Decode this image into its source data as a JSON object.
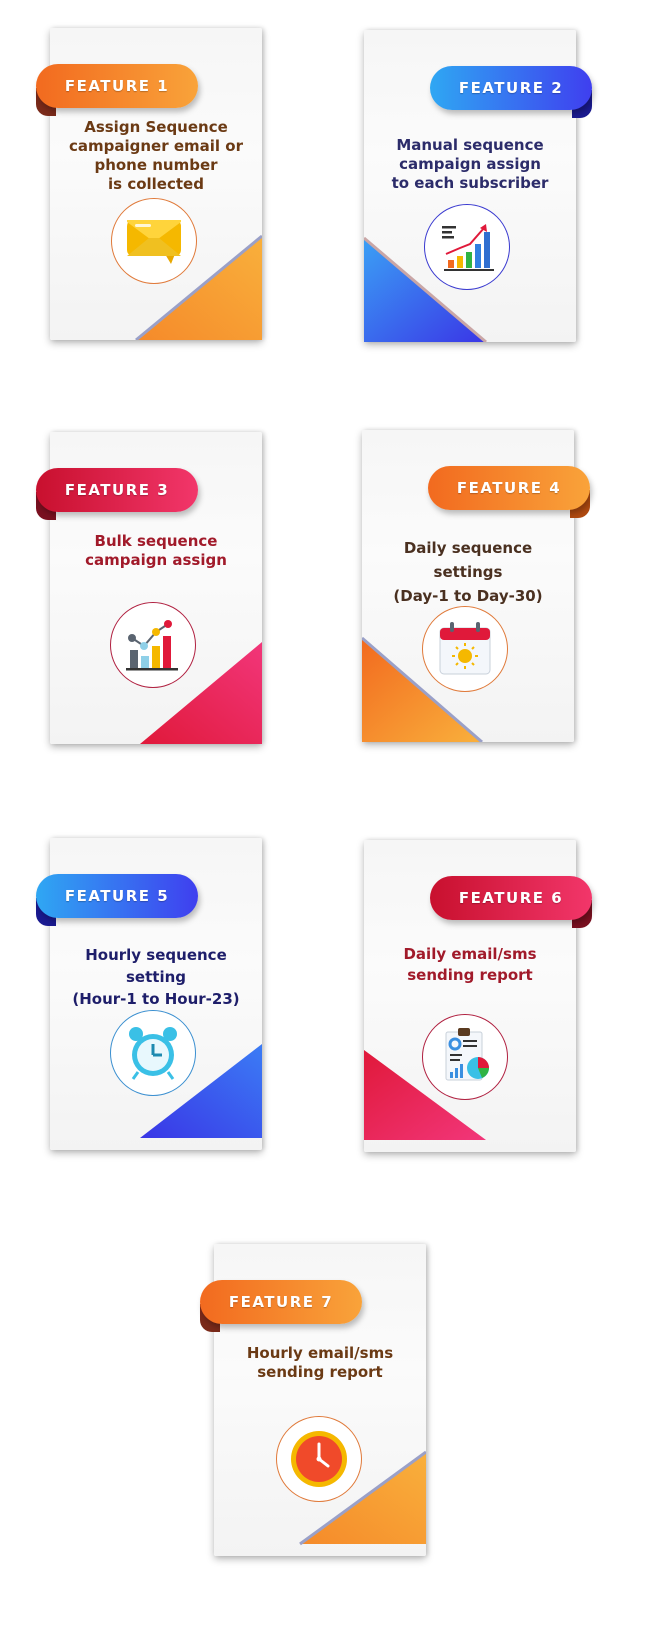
{
  "colors": {
    "orange": "#f57c22",
    "blue": "#3a5bf0",
    "red": "#e0193a",
    "brown_text": "#6b3a14",
    "navy_text": "#2c2c6a",
    "red_text": "#a11a2a"
  },
  "features": [
    {
      "label": "FEATURE 1",
      "lines": [
        "Assign Sequence",
        "campaigner email or",
        "phone number",
        "is collected"
      ],
      "icon": "envelope-icon"
    },
    {
      "label": "FEATURE 2",
      "lines": [
        "Manual sequence",
        "campaign assign",
        "to each subscriber"
      ],
      "icon": "growth-chart-icon"
    },
    {
      "label": "FEATURE 3",
      "lines": [
        "Bulk sequence",
        "campaign assign"
      ],
      "icon": "bar-line-chart-icon"
    },
    {
      "label": "FEATURE 4",
      "lines": [
        "Daily sequence settings",
        "(Day-1 to Day-30)"
      ],
      "icon": "calendar-sun-icon"
    },
    {
      "label": "FEATURE 5",
      "lines": [
        "Hourly sequence setting",
        "(Hour-1 to Hour-23)"
      ],
      "icon": "alarm-clock-icon"
    },
    {
      "label": "FEATURE 6",
      "lines": [
        "Daily email/sms",
        "sending report"
      ],
      "icon": "report-document-icon"
    },
    {
      "label": "FEATURE 7",
      "lines": [
        "Hourly email/sms",
        "sending report"
      ],
      "icon": "clock-icon"
    }
  ]
}
